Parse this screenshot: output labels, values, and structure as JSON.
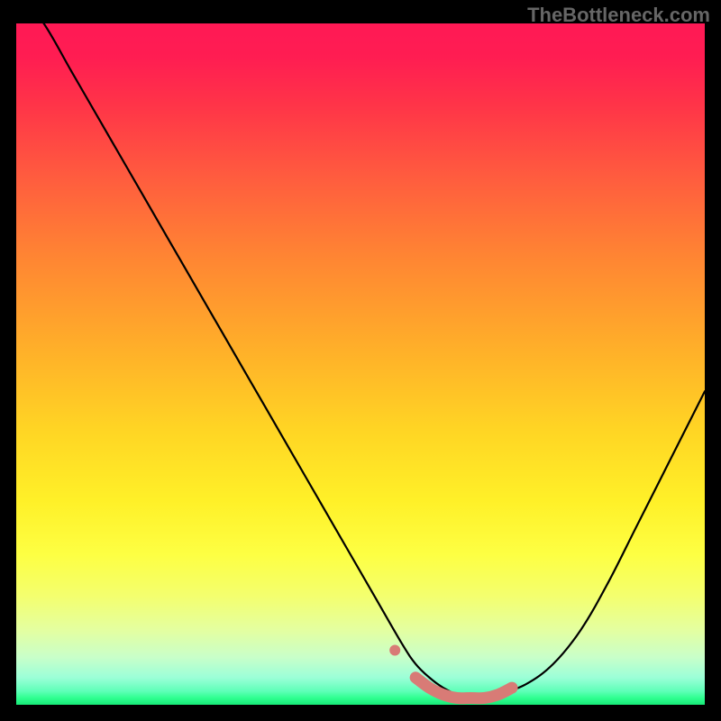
{
  "watermark": "TheBottleneck.com",
  "colors": {
    "page_bg": "#000000",
    "curve": "#000000",
    "highlight": "#d87b76",
    "gradient_top": "#ff1955",
    "gradient_bottom": "#17e877"
  },
  "chart_data": {
    "type": "line",
    "title": "",
    "xlabel": "",
    "ylabel": "",
    "xlim": [
      0,
      100
    ],
    "ylim": [
      0,
      100
    ],
    "series": [
      {
        "name": "bottleneck-curve",
        "x": [
          0,
          4,
          8,
          12,
          16,
          20,
          24,
          28,
          32,
          36,
          40,
          44,
          48,
          52,
          56,
          58,
          60,
          62,
          64,
          66,
          68,
          70,
          74,
          78,
          82,
          86,
          90,
          94,
          98,
          100
        ],
        "values": [
          105,
          100,
          93,
          86,
          79,
          72,
          65,
          58,
          51,
          44,
          37,
          30,
          23,
          16,
          9,
          6,
          4,
          2.5,
          1.5,
          1,
          1,
          1.5,
          3,
          6,
          11,
          18,
          26,
          34,
          42,
          46
        ]
      },
      {
        "name": "highlight-segment",
        "x": [
          55,
          57,
          58,
          60,
          62,
          64,
          66,
          68,
          70,
          72
        ],
        "values": [
          8,
          5,
          4,
          2.5,
          1.5,
          1,
          1,
          1,
          1.5,
          2.5
        ]
      }
    ],
    "annotations": []
  }
}
